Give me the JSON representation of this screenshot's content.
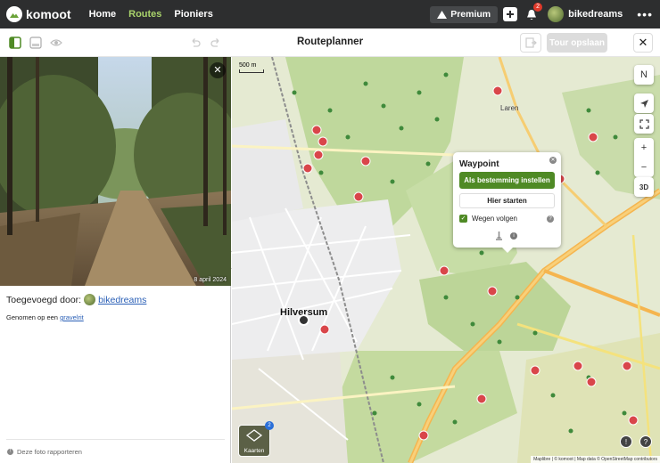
{
  "nav": {
    "brand": "komoot",
    "links": [
      "Home",
      "Routes",
      "Pioniers"
    ],
    "premium": "Premium",
    "notifications": "2",
    "username": "bikedreams",
    "more": "•••"
  },
  "toolbar": {
    "title": "Routeplanner",
    "save": "Tour opslaan",
    "close": "✕"
  },
  "photo": {
    "date": "8 april 2024",
    "close": "✕",
    "added_by_prefix": "Toegevoegd door:",
    "added_by_user": "bikedreams",
    "taken_prefix": "Genomen op een",
    "taken_link": "gravelrit",
    "report": "Deze foto rapporteren"
  },
  "map": {
    "scale": "500 m",
    "town": "Hilversum",
    "town2": "Laren",
    "controls": {
      "compass": "N",
      "zoom_in": "+",
      "zoom_out": "−",
      "three_d": "3D"
    },
    "layers_label": "Kaarten",
    "layers_count": "2",
    "attribution": "Maplibre | © komoot | Map data © OpenStreetMap contributors"
  },
  "waypoint": {
    "title": "Waypoint",
    "set_destination": "Als bestemming instellen",
    "start_here": "Hier starten",
    "follow_roads": "Wegen volgen"
  }
}
